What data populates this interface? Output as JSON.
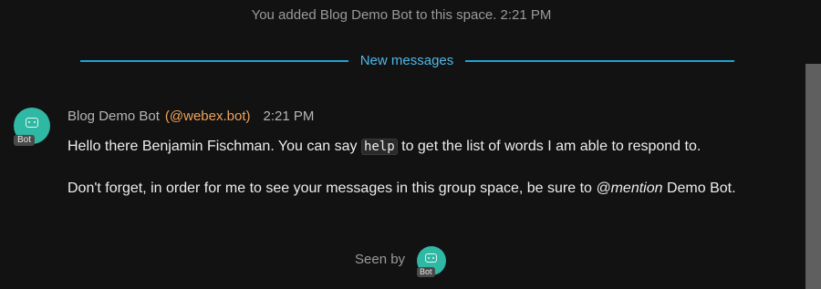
{
  "system_message": "You added Blog Demo Bot to this space. 2:21 PM",
  "divider_label": "New messages",
  "message": {
    "sender": "Blog Demo Bot",
    "handle": "(@webex.bot)",
    "time": "2:21 PM",
    "avatar_badge": "Bot",
    "p1_before": "Hello there Benjamin Fischman. You can say ",
    "p1_code": "help",
    "p1_after": " to get the list of words I am able to respond to.",
    "p2_before": "Don't forget, in order for me to see your messages in this group space, be sure to ",
    "p2_mention": "@mention",
    "p2_after": " Demo Bot."
  },
  "seen_by_label": "Seen by",
  "seen_avatar_badge": "Bot",
  "colors": {
    "background": "#121212",
    "accent": "#1fa3d6",
    "handle": "#f0a35a",
    "avatar": "#2fb8a3"
  },
  "icons": {
    "avatar": "robot-icon"
  }
}
